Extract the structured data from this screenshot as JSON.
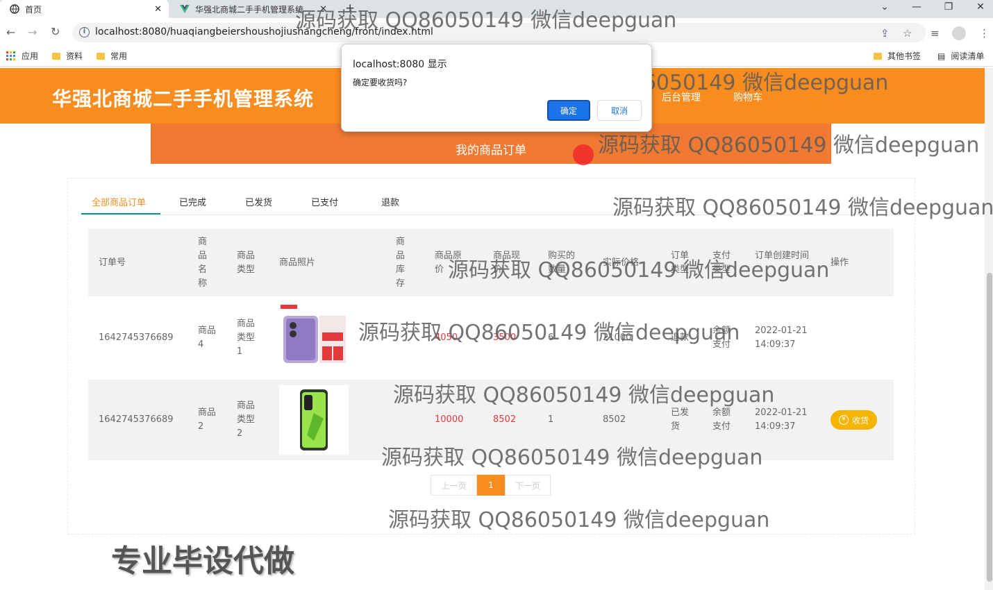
{
  "browser": {
    "tabs": [
      {
        "label": "首页",
        "active": true
      },
      {
        "label": "华强北商城二手手机管理系统",
        "active": false
      }
    ],
    "url": "localhost:8080/huaqiangbeiershoushojiushangcheng/front/index.html",
    "bookmarks": [
      "应用",
      "资料",
      "常用"
    ],
    "bookmarks_right": [
      "其他书签",
      "阅读清单"
    ]
  },
  "site": {
    "title": "华强北商城二手手机管理系统",
    "nav": [
      "后台管理",
      "购物车"
    ],
    "banner": "我的商品订单"
  },
  "order_tabs": [
    "全部商品订单",
    "已完成",
    "已发货",
    "已支付",
    "退款"
  ],
  "table": {
    "headers": {
      "order_no": "订单号",
      "name": "商品名称",
      "type": "商品类型",
      "photo": "商品照片",
      "stock": "商品库存",
      "orig_price": "商品原价",
      "cur_price": "商品现价",
      "qty": "购买的数量",
      "paid": "实际价格",
      "order_type": "订单类型",
      "pay_type": "支付类型",
      "created": "订单创建时间",
      "action": "操作"
    },
    "rows": [
      {
        "order_no": "1642745376689",
        "name": "商品4",
        "type": "商品类型1",
        "stock": "",
        "orig_price": "4050",
        "cur_price": "3500",
        "qty": "6",
        "paid": "21000",
        "order_type": "退款",
        "pay_type": "余额支付",
        "created_date": "2022-01-21",
        "created_time": "14:09:37",
        "action": ""
      },
      {
        "order_no": "1642745376689",
        "name": "商品2",
        "type": "商品类型2",
        "stock": "",
        "orig_price": "10000",
        "cur_price": "8502",
        "qty": "1",
        "paid": "8502",
        "order_type": "已发货",
        "pay_type": "余额支付",
        "created_date": "2022-01-21",
        "created_time": "14:09:37",
        "action": "收货"
      }
    ]
  },
  "pager": {
    "prev": "上一页",
    "current": "1",
    "next": "下一页"
  },
  "dialog": {
    "title": "localhost:8080 显示",
    "message": "确定要收货吗?",
    "ok": "确定",
    "cancel": "取消"
  },
  "watermark": "源码获取 QQ86050149 微信deepguan",
  "watermark_big": "专业毕设代做",
  "colors": {
    "header": "#f98c1f",
    "banner": "#f17a32",
    "price": "#e4393c",
    "receive": "#f6b400",
    "dialog_ok": "#1a73e8"
  }
}
